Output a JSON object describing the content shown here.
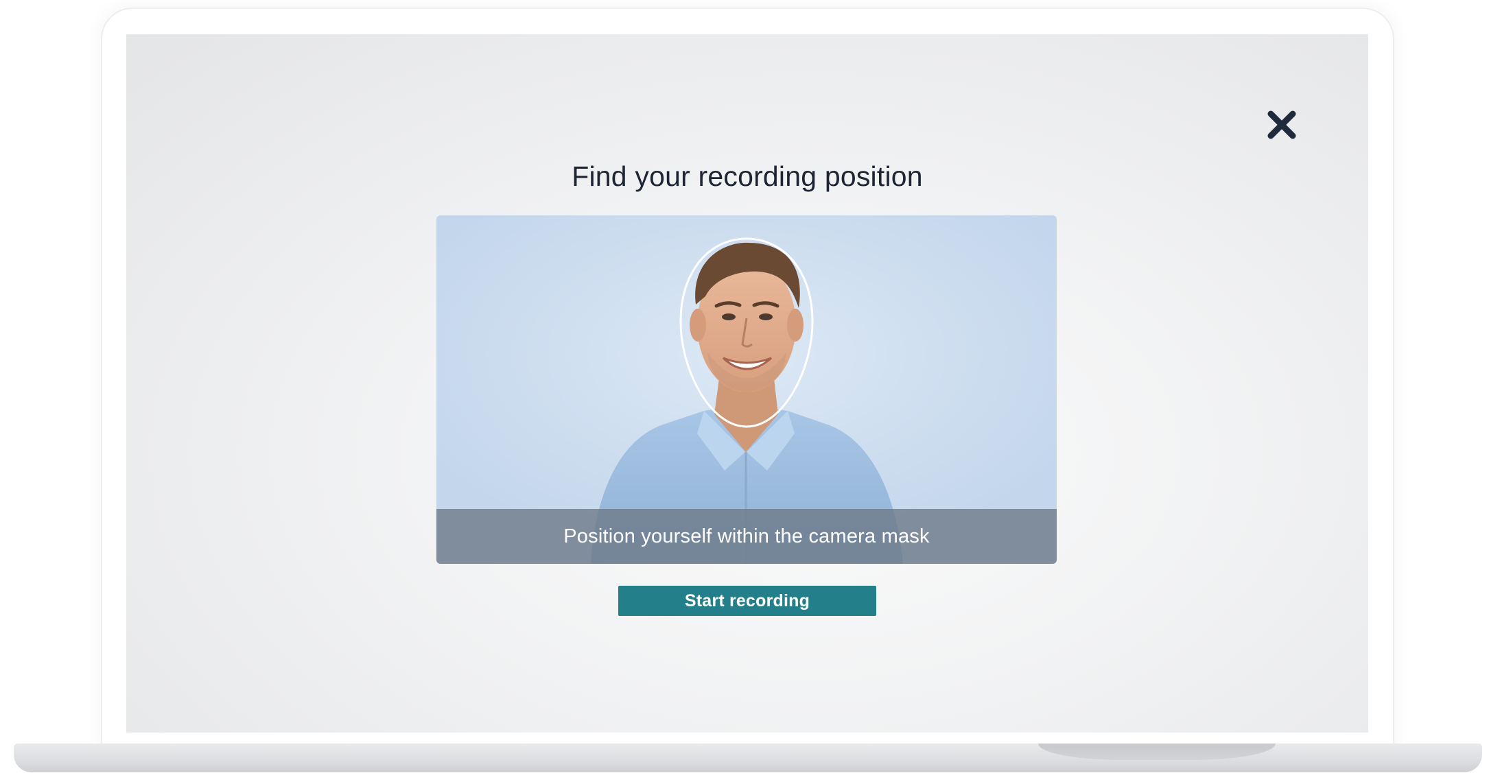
{
  "dialog": {
    "title": "Find your recording position",
    "close_icon": "close-icon"
  },
  "camera": {
    "caption": "Position yourself within the camera mask",
    "mask_icon": "face-outline-mask"
  },
  "actions": {
    "start_label": "Start recording",
    "start_color": "#237f8a"
  },
  "colors": {
    "title_text": "#1d2433",
    "close_icon": "#1f2a3d",
    "caption_bar": "#6e7a8a"
  }
}
